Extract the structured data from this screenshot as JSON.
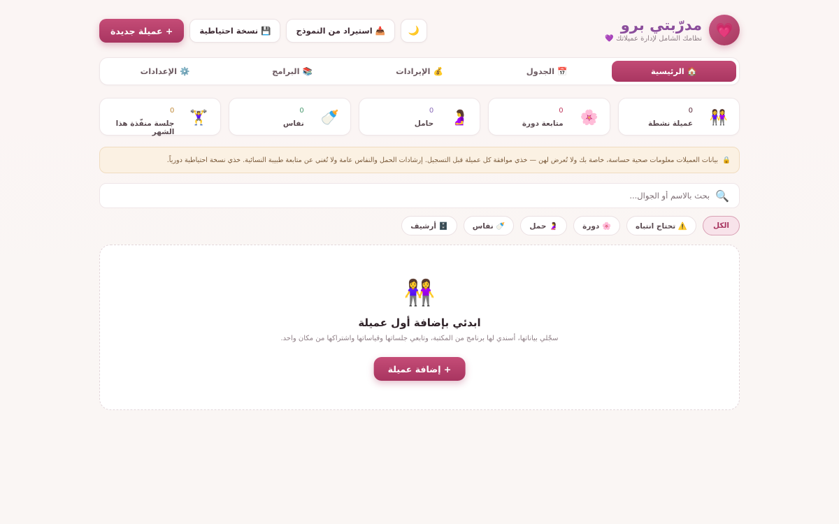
{
  "header": {
    "logo_icon": "💗",
    "title": "مدرّبتي برو",
    "subtitle": "نظامك الشامل لإدارة عميلاتك 💜",
    "actions": {
      "new_client": "+ عميلة جديدة",
      "backup": "💾 نسخة احتياطية",
      "import": "📥 استيراد من النموذج",
      "theme_toggle": "🌙"
    }
  },
  "tabs": [
    {
      "label": "🏠 الرئيسية",
      "active": true
    },
    {
      "label": "📅 الجدول"
    },
    {
      "label": "💰 الإيرادات"
    },
    {
      "label": "📚 البرامج"
    },
    {
      "label": "⚙️ الإعدادات"
    }
  ],
  "stats": [
    {
      "icon": "👭",
      "value": "0",
      "value_color": "#5a2a3a",
      "label": "عميلة نشطة"
    },
    {
      "icon": "🌸",
      "value": "0",
      "value_color": "#c0395f",
      "label": "متابعة دورة"
    },
    {
      "icon": "🤰",
      "value": "0",
      "value_color": "#8a6ab8",
      "label": "حامل"
    },
    {
      "icon": "🍼",
      "value": "0",
      "value_color": "#4a9a70",
      "label": "نفاس"
    },
    {
      "icon": "🏋️‍♀️",
      "value": "0",
      "value_color": "#c08a3a",
      "label": "جلسة منفّذة هذا الشهر"
    }
  ],
  "notice": {
    "icon": "🔒",
    "text": "بيانات العميلات معلومات صحية حساسة، خاصة بك ولا تُعرض لهن — خذي موافقة كل عميلة قبل التسجيل. إرشادات الحمل والنفاس عامة ولا تُغني عن متابعة طبيبة النسائية. خذي نسخة احتياطية دورياً."
  },
  "search": {
    "icon": "🔍",
    "placeholder": "بحث بالاسم أو الجوال..."
  },
  "filters": [
    {
      "label": "الكل",
      "active": true
    },
    {
      "label": "⚠️ تحتاج انتباه"
    },
    {
      "label": "🌸 دورة"
    },
    {
      "label": "🤰 حمل"
    },
    {
      "label": "🍼 نفاس"
    },
    {
      "label": "🗄️ أرشيف"
    }
  ],
  "empty_state": {
    "icon": "👭",
    "title": "ابدئي بإضافة أول عميلة",
    "description": "سجّلي بياناتها، أسندي لها برنامج من المكتبة، وتابعي جلساتها وقياساتها واشتراكها من مكان واحد.",
    "button": "+ إضافة عميلة"
  },
  "colors": {
    "accent": "#b03e66",
    "brand_title": "#8b4e9c",
    "notice_bg": "#fbf1e3"
  }
}
